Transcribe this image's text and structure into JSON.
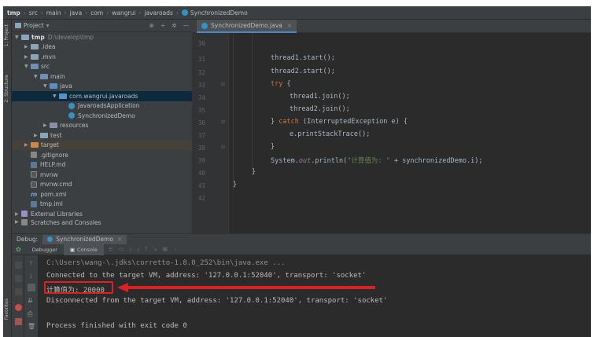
{
  "breadcrumb": [
    "tmp",
    "src",
    "main",
    "java",
    "com",
    "wangrui",
    "javaroads",
    "SynchronizedDemo"
  ],
  "left_tool_tabs": [
    "1: Project",
    "2: Structure",
    "Favorites"
  ],
  "project_panel": {
    "title": "Project",
    "tree": [
      {
        "label": "tmp",
        "extra": "D:\\develop\\tmp"
      },
      {
        "label": ".idea"
      },
      {
        "label": ".mvn"
      },
      {
        "label": "src"
      },
      {
        "label": "main"
      },
      {
        "label": "java"
      },
      {
        "label": "com.wangrui.javaroads"
      },
      {
        "label": "JavaroadsApplication"
      },
      {
        "label": "SynchronizedDemo"
      },
      {
        "label": "resources"
      },
      {
        "label": "test"
      },
      {
        "label": "target"
      },
      {
        "label": ".gitignore"
      },
      {
        "label": "HELP.md"
      },
      {
        "label": "mvnw"
      },
      {
        "label": "mvnw.cmd"
      },
      {
        "label": "pom.xml"
      },
      {
        "label": "tmp.iml"
      },
      {
        "label": "External Libraries"
      },
      {
        "label": "Scratches and Consoles"
      }
    ]
  },
  "editor": {
    "tab_label": "SynchronizedDemo.java",
    "line_numbers": [
      "30",
      "31",
      "32",
      "33",
      "34",
      "35",
      "36",
      "37",
      "38",
      "39",
      "40",
      "41",
      "42"
    ],
    "code": {
      "l31_a": "thread1.start();",
      "l32_a": "thread2.start();",
      "l33_kw": "try",
      "l33_b": " {",
      "l34_a": "thread1.join();",
      "l35_a": "thread2.join();",
      "l36_a": "} ",
      "l36_kw": "catch",
      "l36_b": " (InterruptedException e) {",
      "l37_a": "e.printStackTrace();",
      "l38_a": "}",
      "l39_a": "System.",
      "l39_fld": "out",
      "l39_b": ".println(",
      "l39_str": "\"计算值为: \"",
      "l39_c": " + synchronizedDemo.i);",
      "l40_a": "}",
      "l41_a": "}"
    }
  },
  "debug": {
    "label": "Debug:",
    "session_tab": "SynchronizedDemo",
    "subtabs": {
      "debugger": "Debugger",
      "console": "Console"
    }
  },
  "console": {
    "lines": {
      "cmd": "C:\\Users\\wang-\\.jdks\\corretto-1.8.0_252\\bin\\java.exe ...",
      "connected": "Connected to the target VM, address: '127.0.0.1:52040', transport: 'socket'",
      "result": "计算值为: 20000",
      "disconnected": "Disconnected from the target VM, address: '127.0.0.1:52040', transport: 'socket'",
      "finished": "Process finished with exit code 0"
    }
  },
  "colors": {
    "keyword": "#cc7832",
    "string": "#6a8759",
    "field": "#9876aa",
    "annotation_red": "#e02020",
    "selection": "#0d293e"
  }
}
